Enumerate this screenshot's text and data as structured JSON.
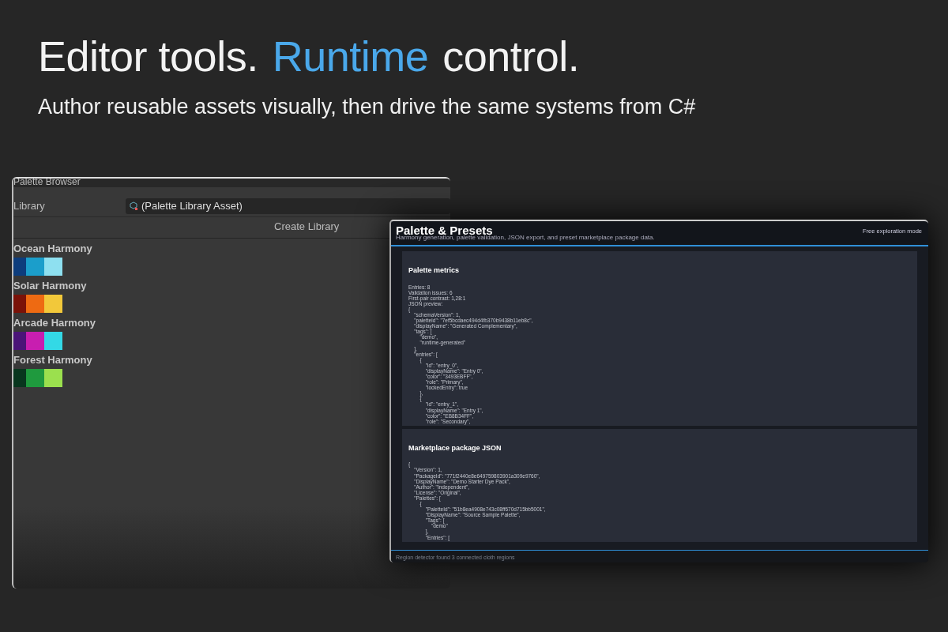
{
  "hero": {
    "title_parts": [
      {
        "text": "Editor tools.",
        "accent": false
      },
      {
        "text": "Runtime",
        "accent": true
      },
      {
        "text": "control.",
        "accent": false
      }
    ],
    "subtitle": "Author reusable assets visually, then drive the same systems from C#"
  },
  "palette_browser": {
    "title": "Palette Browser",
    "library_label": "Library",
    "library_value": "(Palette Library Asset)",
    "create_button": "Create Library",
    "palettes": [
      {
        "name": "Ocean Harmony",
        "swatches": [
          {
            "color": "#0d3d7d"
          },
          {
            "color": "#1b9ecb"
          },
          {
            "color": "#8ee0f0"
          }
        ]
      },
      {
        "name": "Solar Harmony",
        "swatches": [
          {
            "color": "#7a1208"
          },
          {
            "color": "#ee6a12"
          },
          {
            "color": "#f2c83a"
          }
        ]
      },
      {
        "name": "Arcade Harmony",
        "swatches": [
          {
            "color": "#4a1478"
          },
          {
            "color": "#c81eb0"
          },
          {
            "color": "#33d9e6"
          }
        ]
      },
      {
        "name": "Forest Harmony",
        "swatches": [
          {
            "color": "#08361e"
          },
          {
            "color": "#1f9a3e"
          },
          {
            "color": "#9be04e"
          }
        ]
      }
    ]
  },
  "presets_window": {
    "title": "Palette & Presets",
    "subtitle": "Harmony generation, palette validation, JSON export, and preset marketplace package data.",
    "mode": "Free exploration mode",
    "panels": [
      {
        "title": "Palette metrics",
        "body": "Entries: 8\nValidation issues: 6\nFirst-pair contrast: 1,28:1\nJSON preview:\n{\n    \"schemaVersion\": 1,\n    \"paletteId\": \"7ef5bcdaec494d4fb370b9438b11eb8c\",\n    \"displayName\": \"Generated Complementary\",\n    \"tags\": [\n        \"demo\",\n        \"runtime-generated\"\n    ],\n    \"entries\": [\n        {\n            \"id\": \"entry_0\",\n            \"displayName\": \"Entry 0\",\n            \"color\": \"3493EBFF\",\n            \"role\": \"Primary\",\n            \"lockedEntry\": true\n        },\n        {\n            \"id\": \"entry_1\",\n            \"displayName\": \"Entry 1\",\n            \"color\": \"EB8B34FF\",\n            \"role\": \"Secondary\","
      },
      {
        "title": "Marketplace package JSON",
        "body": "{\n    \"Version\": 1,\n    \"PackageId\": \"771f2440e8e649759803901a309e9760\",\n    \"DisplayName\": \"Demo Starter Dye Pack\",\n    \"Author\": \"Independent\",\n    \"License\": \"Original\",\n    \"Palettes\": [\n        {\n            \"PaletteId\": \"51b8ea4908e743c08ff670d715bb5001\",\n            \"DisplayName\": \"Source Sample Palette\",\n            \"Tags\": [\n                \"demo\"\n            ],\n            \"Entries\": ["
      }
    ],
    "status": "Region detector found 3 connected cloth regions"
  }
}
